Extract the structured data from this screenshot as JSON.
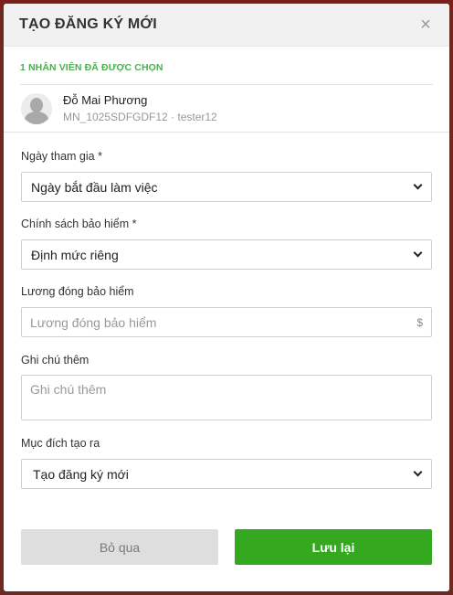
{
  "modal": {
    "title": "TẠO ĐĂNG KÝ MỚI",
    "close_label": "×"
  },
  "selection": {
    "count_text": "1 NHÂN VIÊN ĐÃ ĐƯỢC CHỌN",
    "employee": {
      "name": "Đỗ Mai Phương",
      "meta": "MN_1025SDFGDF12 · tester12",
      "avatar_icon": "user-silhouette-icon"
    }
  },
  "form": {
    "join_date": {
      "label": "Ngày tham gia *",
      "value": "Ngày bắt đầu làm việc"
    },
    "insurance_policy": {
      "label": "Chính sách bảo hiểm *",
      "value": "Định mức riêng"
    },
    "insurance_salary": {
      "label": "Lương đóng bảo hiểm",
      "placeholder": "Lương đóng bảo hiểm",
      "value": "",
      "suffix": "$"
    },
    "note": {
      "label": "Ghi chú thêm",
      "placeholder": "Ghi chú thêm",
      "value": ""
    },
    "purpose": {
      "label": "Mục đích tạo ra",
      "value": "Tạo đăng ký mới"
    }
  },
  "actions": {
    "cancel_label": "Bỏ qua",
    "save_label": "Lưu lại"
  },
  "colors": {
    "accent_green": "#34a81e",
    "count_green": "#4caf50",
    "backdrop": "#6b2a22"
  }
}
